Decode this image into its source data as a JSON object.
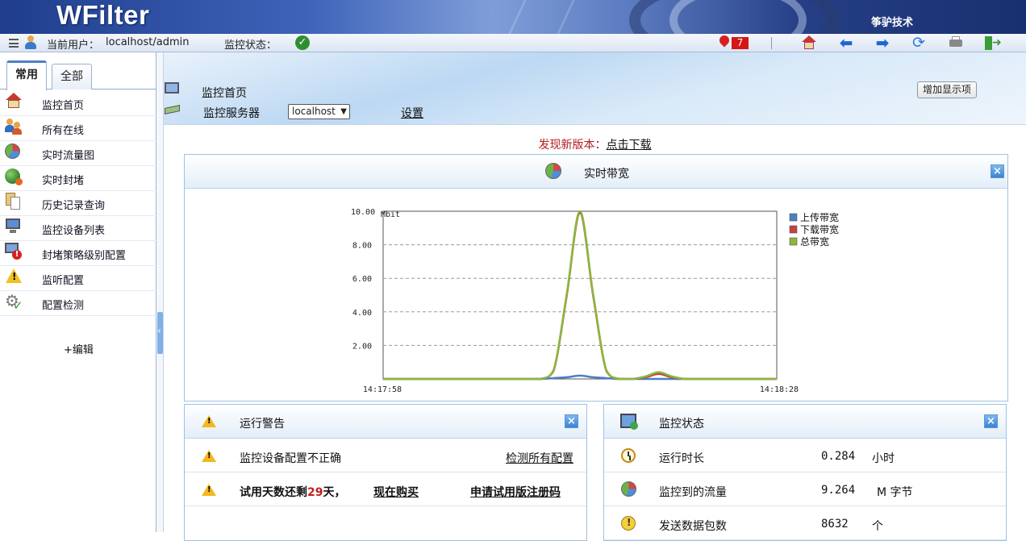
{
  "banner": {
    "logo": "WFilter",
    "company": "筝驴技术"
  },
  "toolbar": {
    "current_user_label": "当前用户：",
    "current_user": "localhost/admin",
    "monitor_status_label": "监控状态：",
    "monitor_status_icon": "check-circle-icon",
    "alert_count": "7",
    "icons": [
      "home-icon",
      "back-arrow-icon",
      "forward-arrow-icon",
      "refresh-icon",
      "print-icon",
      "logout-icon"
    ]
  },
  "sidebar": {
    "tabs": [
      {
        "label": "常用",
        "active": true
      },
      {
        "label": "全部",
        "active": false
      }
    ],
    "items": [
      {
        "label": "监控首页",
        "icon": "home-icon"
      },
      {
        "label": "所有在线",
        "icon": "users-icon"
      },
      {
        "label": "实时流量图",
        "icon": "pie-chart-icon"
      },
      {
        "label": "实时封堵",
        "icon": "globe-block-icon"
      },
      {
        "label": "历史记录查询",
        "icon": "documents-icon"
      },
      {
        "label": "监控设备列表",
        "icon": "monitor-icon"
      },
      {
        "label": "封堵策略级别配置",
        "icon": "monitor-block-icon"
      },
      {
        "label": "监听配置",
        "icon": "warning-icon"
      },
      {
        "label": "配置检测",
        "icon": "gear-check-icon"
      }
    ],
    "edit_label": "+编辑"
  },
  "main": {
    "page_title": "监控首页",
    "add_display_button": "增加显示项",
    "server_label": "监控服务器",
    "server_selected": "localhost",
    "settings_link": "设置",
    "notice_text": "发现新版本：",
    "notice_link": "点击下载"
  },
  "bandwidth_panel": {
    "title": "实时带宽"
  },
  "chart_data": {
    "type": "line",
    "title": "",
    "unit": "Mbit",
    "ylim": [
      0,
      10
    ],
    "y_ticks": [
      "10.00",
      "8.00",
      "6.00",
      "4.00",
      "2.00"
    ],
    "x_start_label": "14:17:58",
    "x_end_label": "14:18:28",
    "x": [
      0,
      1,
      2,
      3,
      4,
      5,
      6,
      7,
      8,
      9,
      10,
      11,
      12,
      13,
      14,
      15,
      16,
      17,
      18,
      19,
      20,
      21,
      22,
      23,
      24,
      25,
      26,
      27,
      28,
      29,
      30
    ],
    "series": [
      {
        "name": "上传带宽",
        "color": "#4a7fc8",
        "values": [
          0,
          0,
          0,
          0,
          0,
          0,
          0,
          0,
          0,
          0,
          0,
          0,
          0,
          0.05,
          0.1,
          0.2,
          0.1,
          0.05,
          0,
          0,
          0,
          0,
          0,
          0,
          0,
          0,
          0,
          0,
          0,
          0,
          0
        ]
      },
      {
        "name": "下载带宽",
        "color": "#c84040",
        "values": [
          0,
          0,
          0,
          0,
          0,
          0,
          0,
          0,
          0,
          0,
          0,
          0,
          0,
          0.5,
          5.0,
          9.9,
          5.0,
          0.5,
          0,
          0,
          0.1,
          0.3,
          0.1,
          0,
          0,
          0,
          0,
          0,
          0,
          0,
          0
        ]
      },
      {
        "name": "总带宽",
        "color": "#8ab83e",
        "values": [
          0,
          0,
          0,
          0,
          0,
          0,
          0,
          0,
          0,
          0,
          0,
          0,
          0,
          0.55,
          5.1,
          10.0,
          5.1,
          0.55,
          0,
          0,
          0.15,
          0.4,
          0.15,
          0,
          0,
          0,
          0,
          0,
          0,
          0,
          0
        ]
      }
    ],
    "grid": true,
    "legend": "right"
  },
  "warnings_panel": {
    "title": "运行警告",
    "rows": [
      {
        "text": "监控设备配置不正确",
        "link": "检测所有配置"
      },
      {
        "text_prefix": "试用天数还剩",
        "days": "29",
        "text_suffix": "天，",
        "buy_link": "现在购买",
        "register_link": "申请试用版注册码"
      }
    ]
  },
  "status_panel": {
    "title": "监控状态",
    "rows": [
      {
        "label": "运行时长",
        "value": "0.284",
        "unit": "小时"
      },
      {
        "label": "监控到的流量",
        "value": "9.264",
        "unit": "M 字节"
      },
      {
        "label": "发送数据包数",
        "value": "8632",
        "unit": "个"
      }
    ]
  }
}
